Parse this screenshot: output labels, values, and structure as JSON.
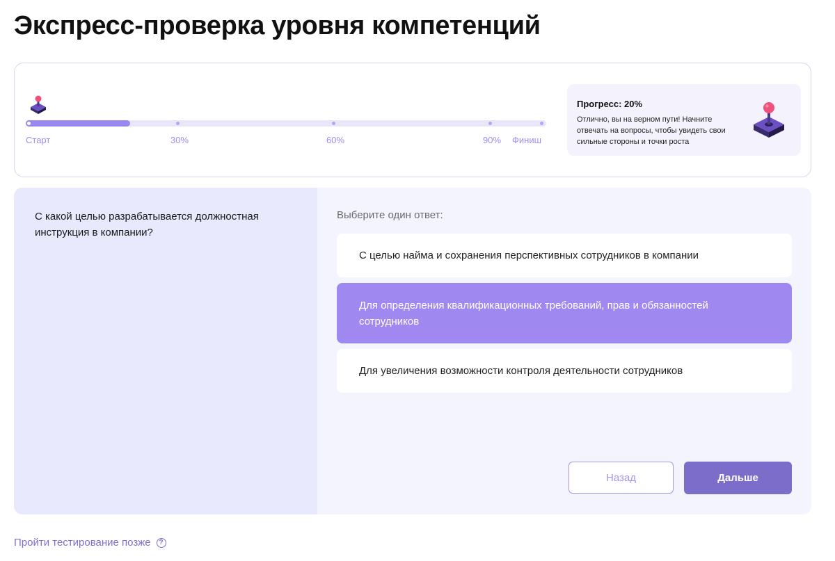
{
  "page": {
    "title": "Экспресс-проверка уровня компетенций"
  },
  "progress": {
    "value": 0.2,
    "labels": {
      "start": "Старт",
      "p30": "30%",
      "p60": "60%",
      "p90": "90%",
      "finish": "Финиш"
    },
    "tip_title": "Прогресс: 20%",
    "tip_text": "Отлично, вы на верном пути! Начните отвечать на вопросы, чтобы увидеть свои сильные стороны и точки роста",
    "icon": "joystick-icon"
  },
  "quiz": {
    "question": "С какой целью разрабатывается должностная инструкция в компании?",
    "prompt": "Выберите один ответ:",
    "options": [
      {
        "label": "С целью найма и сохранения перспективных сотрудников в компании",
        "selected": false
      },
      {
        "label": "Для определения квалификационных требований, прав и обязанностей сотрудников",
        "selected": true
      },
      {
        "label": "Для увеличения возможности контроля деятельности сотрудников",
        "selected": false
      }
    ],
    "back_label": "Назад",
    "next_label": "Дальше"
  },
  "footer": {
    "later_label": "Пройти тестирование позже",
    "later_icon": "help-circle-icon"
  },
  "colors": {
    "accent": "#9f89f1",
    "accent_dark": "#7d6dcb",
    "track": "#e9e6fb",
    "quiz_bg": "#f3f4fd",
    "quiz_left_bg": "#e8e9fc"
  }
}
